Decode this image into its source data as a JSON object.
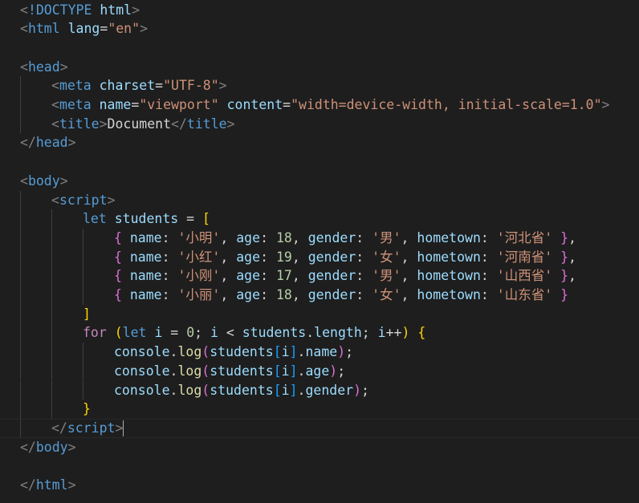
{
  "colors": {
    "background": "#1e1e1e",
    "punctuation": "#808080",
    "tag": "#569cd6",
    "attribute": "#9cdcfe",
    "string": "#ce9178",
    "keyword_control": "#c586c0",
    "number": "#b5cea8",
    "function": "#dcdcaa",
    "bracket_level1": "#ffd700",
    "bracket_level2": "#da70d6",
    "bracket_level3": "#179fff"
  },
  "editor": {
    "active_line": 22,
    "cursor_line": 22,
    "lines": [
      {
        "indent": 0,
        "tokens": [
          [
            "t-punc",
            "<"
          ],
          [
            "t-tag",
            "!DOCTYPE"
          ],
          [
            "t-text",
            " "
          ],
          [
            "t-attr",
            "html"
          ],
          [
            "t-punc",
            ">"
          ]
        ]
      },
      {
        "indent": 0,
        "tokens": [
          [
            "t-punc",
            "<"
          ],
          [
            "t-tag",
            "html"
          ],
          [
            "t-text",
            " "
          ],
          [
            "t-attr",
            "lang"
          ],
          [
            "t-text",
            "="
          ],
          [
            "t-str",
            "\"en\""
          ],
          [
            "t-punc",
            ">"
          ]
        ]
      },
      {
        "indent": 0,
        "tokens": []
      },
      {
        "indent": 0,
        "tokens": [
          [
            "t-punc",
            "<"
          ],
          [
            "t-tag",
            "head"
          ],
          [
            "t-punc",
            ">"
          ]
        ]
      },
      {
        "indent": 1,
        "tokens": [
          [
            "t-punc",
            "<"
          ],
          [
            "t-tag",
            "meta"
          ],
          [
            "t-text",
            " "
          ],
          [
            "t-attr",
            "charset"
          ],
          [
            "t-text",
            "="
          ],
          [
            "t-str",
            "\"UTF-8\""
          ],
          [
            "t-punc",
            ">"
          ]
        ]
      },
      {
        "indent": 1,
        "tokens": [
          [
            "t-punc",
            "<"
          ],
          [
            "t-tag",
            "meta"
          ],
          [
            "t-text",
            " "
          ],
          [
            "t-attr",
            "name"
          ],
          [
            "t-text",
            "="
          ],
          [
            "t-str",
            "\"viewport\""
          ],
          [
            "t-text",
            " "
          ],
          [
            "t-attr",
            "content"
          ],
          [
            "t-text",
            "="
          ],
          [
            "t-str",
            "\"width=device-width, initial-scale=1.0\""
          ],
          [
            "t-punc",
            ">"
          ]
        ]
      },
      {
        "indent": 1,
        "tokens": [
          [
            "t-punc",
            "<"
          ],
          [
            "t-tag",
            "title"
          ],
          [
            "t-punc",
            ">"
          ],
          [
            "t-text",
            "Document"
          ],
          [
            "t-punc",
            "</"
          ],
          [
            "t-tag",
            "title"
          ],
          [
            "t-punc",
            ">"
          ]
        ]
      },
      {
        "indent": 0,
        "tokens": [
          [
            "t-punc",
            "</"
          ],
          [
            "t-tag",
            "head"
          ],
          [
            "t-punc",
            ">"
          ]
        ]
      },
      {
        "indent": 0,
        "tokens": []
      },
      {
        "indent": 0,
        "tokens": [
          [
            "t-punc",
            "<"
          ],
          [
            "t-tag",
            "body"
          ],
          [
            "t-punc",
            ">"
          ]
        ]
      },
      {
        "indent": 1,
        "tokens": [
          [
            "t-punc",
            "<"
          ],
          [
            "t-tag",
            "script"
          ],
          [
            "t-punc",
            ">"
          ]
        ]
      },
      {
        "indent": 2,
        "tokens": [
          [
            "t-kw",
            "let"
          ],
          [
            "t-text",
            " "
          ],
          [
            "t-var",
            "students"
          ],
          [
            "t-op",
            " = "
          ],
          [
            "t-b1",
            "["
          ]
        ]
      },
      {
        "indent": 3,
        "tokens": [
          [
            "t-b2",
            "{"
          ],
          [
            "t-text",
            " "
          ],
          [
            "t-var",
            "name"
          ],
          [
            "t-op",
            ": "
          ],
          [
            "t-str",
            "'小明'"
          ],
          [
            "t-op",
            ", "
          ],
          [
            "t-var",
            "age"
          ],
          [
            "t-op",
            ": "
          ],
          [
            "t-num",
            "18"
          ],
          [
            "t-op",
            ", "
          ],
          [
            "t-var",
            "gender"
          ],
          [
            "t-op",
            ": "
          ],
          [
            "t-str",
            "'男'"
          ],
          [
            "t-op",
            ", "
          ],
          [
            "t-var",
            "hometown"
          ],
          [
            "t-op",
            ": "
          ],
          [
            "t-str",
            "'河北省'"
          ],
          [
            "t-text",
            " "
          ],
          [
            "t-b2",
            "}"
          ],
          [
            "t-op",
            ","
          ]
        ]
      },
      {
        "indent": 3,
        "tokens": [
          [
            "t-b2",
            "{"
          ],
          [
            "t-text",
            " "
          ],
          [
            "t-var",
            "name"
          ],
          [
            "t-op",
            ": "
          ],
          [
            "t-str",
            "'小红'"
          ],
          [
            "t-op",
            ", "
          ],
          [
            "t-var",
            "age"
          ],
          [
            "t-op",
            ": "
          ],
          [
            "t-num",
            "19"
          ],
          [
            "t-op",
            ", "
          ],
          [
            "t-var",
            "gender"
          ],
          [
            "t-op",
            ": "
          ],
          [
            "t-str",
            "'女'"
          ],
          [
            "t-op",
            ", "
          ],
          [
            "t-var",
            "hometown"
          ],
          [
            "t-op",
            ": "
          ],
          [
            "t-str",
            "'河南省'"
          ],
          [
            "t-text",
            " "
          ],
          [
            "t-b2",
            "}"
          ],
          [
            "t-op",
            ","
          ]
        ]
      },
      {
        "indent": 3,
        "tokens": [
          [
            "t-b2",
            "{"
          ],
          [
            "t-text",
            " "
          ],
          [
            "t-var",
            "name"
          ],
          [
            "t-op",
            ": "
          ],
          [
            "t-str",
            "'小刚'"
          ],
          [
            "t-op",
            ", "
          ],
          [
            "t-var",
            "age"
          ],
          [
            "t-op",
            ": "
          ],
          [
            "t-num",
            "17"
          ],
          [
            "t-op",
            ", "
          ],
          [
            "t-var",
            "gender"
          ],
          [
            "t-op",
            ": "
          ],
          [
            "t-str",
            "'男'"
          ],
          [
            "t-op",
            ", "
          ],
          [
            "t-var",
            "hometown"
          ],
          [
            "t-op",
            ": "
          ],
          [
            "t-str",
            "'山西省'"
          ],
          [
            "t-text",
            " "
          ],
          [
            "t-b2",
            "}"
          ],
          [
            "t-op",
            ","
          ]
        ]
      },
      {
        "indent": 3,
        "tokens": [
          [
            "t-b2",
            "{"
          ],
          [
            "t-text",
            " "
          ],
          [
            "t-var",
            "name"
          ],
          [
            "t-op",
            ": "
          ],
          [
            "t-str",
            "'小丽'"
          ],
          [
            "t-op",
            ", "
          ],
          [
            "t-var",
            "age"
          ],
          [
            "t-op",
            ": "
          ],
          [
            "t-num",
            "18"
          ],
          [
            "t-op",
            ", "
          ],
          [
            "t-var",
            "gender"
          ],
          [
            "t-op",
            ": "
          ],
          [
            "t-str",
            "'女'"
          ],
          [
            "t-op",
            ", "
          ],
          [
            "t-var",
            "hometown"
          ],
          [
            "t-op",
            ": "
          ],
          [
            "t-str",
            "'山东省'"
          ],
          [
            "t-text",
            " "
          ],
          [
            "t-b2",
            "}"
          ]
        ]
      },
      {
        "indent": 2,
        "tokens": [
          [
            "t-b1",
            "]"
          ]
        ]
      },
      {
        "indent": 2,
        "tokens": [
          [
            "t-kw2",
            "for"
          ],
          [
            "t-text",
            " "
          ],
          [
            "t-b1",
            "("
          ],
          [
            "t-kw",
            "let"
          ],
          [
            "t-text",
            " "
          ],
          [
            "t-var",
            "i"
          ],
          [
            "t-op",
            " = "
          ],
          [
            "t-num",
            "0"
          ],
          [
            "t-op",
            "; "
          ],
          [
            "t-var",
            "i"
          ],
          [
            "t-op",
            " < "
          ],
          [
            "t-var",
            "students"
          ],
          [
            "t-op",
            "."
          ],
          [
            "t-var",
            "length"
          ],
          [
            "t-op",
            "; "
          ],
          [
            "t-var",
            "i"
          ],
          [
            "t-op",
            "++"
          ],
          [
            "t-b1",
            ")"
          ],
          [
            "t-text",
            " "
          ],
          [
            "t-b1",
            "{"
          ]
        ]
      },
      {
        "indent": 3,
        "tokens": [
          [
            "t-var",
            "console"
          ],
          [
            "t-op",
            "."
          ],
          [
            "t-fn",
            "log"
          ],
          [
            "t-b2",
            "("
          ],
          [
            "t-var",
            "students"
          ],
          [
            "t-b3",
            "["
          ],
          [
            "t-var",
            "i"
          ],
          [
            "t-b3",
            "]"
          ],
          [
            "t-op",
            "."
          ],
          [
            "t-var",
            "name"
          ],
          [
            "t-b2",
            ")"
          ],
          [
            "t-op",
            ";"
          ]
        ]
      },
      {
        "indent": 3,
        "tokens": [
          [
            "t-var",
            "console"
          ],
          [
            "t-op",
            "."
          ],
          [
            "t-fn",
            "log"
          ],
          [
            "t-b2",
            "("
          ],
          [
            "t-var",
            "students"
          ],
          [
            "t-b3",
            "["
          ],
          [
            "t-var",
            "i"
          ],
          [
            "t-b3",
            "]"
          ],
          [
            "t-op",
            "."
          ],
          [
            "t-var",
            "age"
          ],
          [
            "t-b2",
            ")"
          ],
          [
            "t-op",
            ";"
          ]
        ]
      },
      {
        "indent": 3,
        "tokens": [
          [
            "t-var",
            "console"
          ],
          [
            "t-op",
            "."
          ],
          [
            "t-fn",
            "log"
          ],
          [
            "t-b2",
            "("
          ],
          [
            "t-var",
            "students"
          ],
          [
            "t-b3",
            "["
          ],
          [
            "t-var",
            "i"
          ],
          [
            "t-b3",
            "]"
          ],
          [
            "t-op",
            "."
          ],
          [
            "t-var",
            "gender"
          ],
          [
            "t-b2",
            ")"
          ],
          [
            "t-op",
            ";"
          ]
        ]
      },
      {
        "indent": 2,
        "tokens": [
          [
            "t-b1",
            "}"
          ]
        ]
      },
      {
        "indent": 1,
        "tokens": [
          [
            "t-punc",
            "</"
          ],
          [
            "t-tag",
            "script"
          ],
          [
            "t-punc",
            ">"
          ]
        ]
      },
      {
        "indent": 0,
        "tokens": [
          [
            "t-punc",
            "</"
          ],
          [
            "t-tag",
            "body"
          ],
          [
            "t-punc",
            ">"
          ]
        ]
      },
      {
        "indent": 0,
        "tokens": []
      },
      {
        "indent": 0,
        "tokens": [
          [
            "t-punc",
            "</"
          ],
          [
            "t-tag",
            "html"
          ],
          [
            "t-punc",
            ">"
          ]
        ]
      }
    ]
  }
}
